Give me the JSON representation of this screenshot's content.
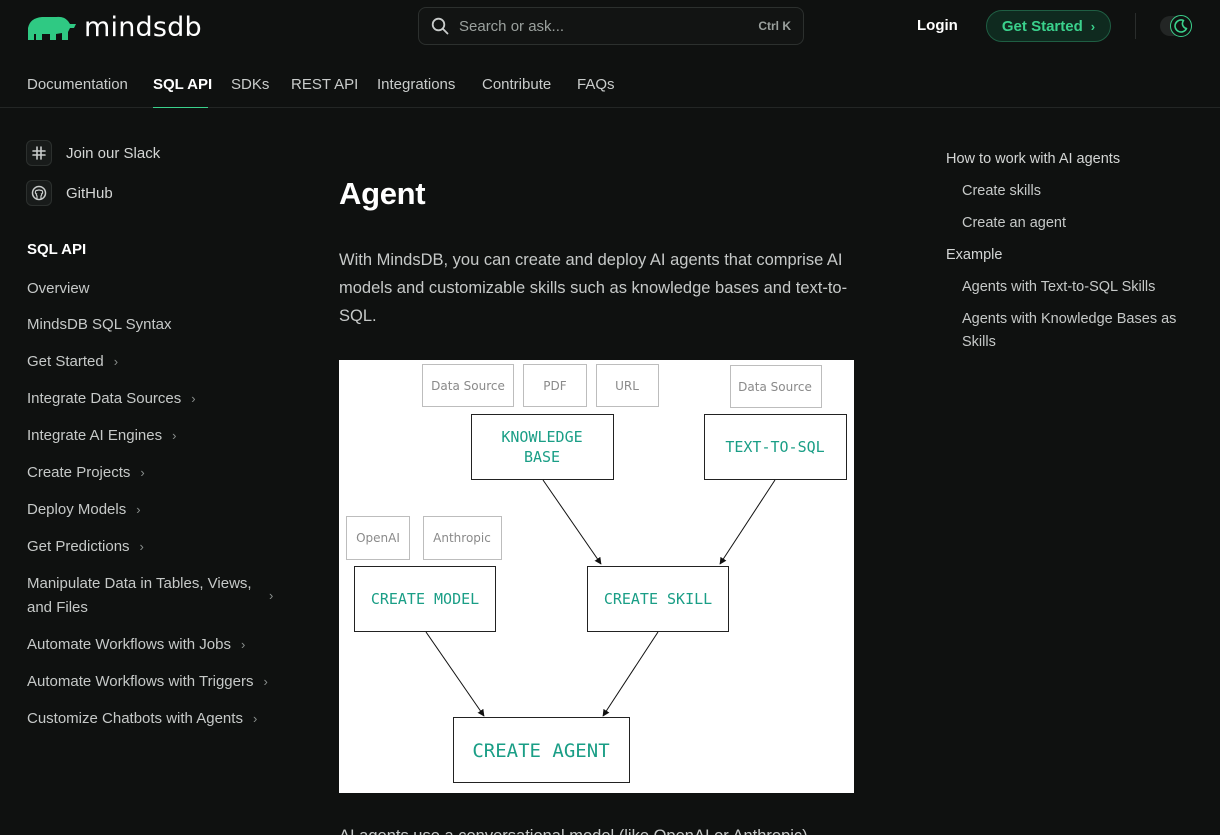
{
  "brand": {
    "logo_text": "mindsdb",
    "accent": "#3ad18c",
    "logo_color": "#2fc983"
  },
  "header": {
    "search_placeholder": "Search or ask...",
    "search_shortcut": "Ctrl K",
    "login_label": "Login",
    "get_started_label": "Get Started"
  },
  "nav": {
    "tabs": [
      {
        "label": "Documentation"
      },
      {
        "label": "SQL API",
        "active": true
      },
      {
        "label": "SDKs"
      },
      {
        "label": "REST API"
      },
      {
        "label": "Integrations"
      },
      {
        "label": "Contribute"
      },
      {
        "label": "FAQs"
      }
    ]
  },
  "sidebar": {
    "links": [
      {
        "label": "Join our Slack",
        "icon": "slack-icon"
      },
      {
        "label": "GitHub",
        "icon": "github-icon"
      }
    ],
    "section_title": "SQL API",
    "items": [
      {
        "label": "Overview"
      },
      {
        "label": "MindsDB SQL Syntax"
      },
      {
        "label": "Get Started",
        "expandable": true
      },
      {
        "label": "Integrate Data Sources",
        "expandable": true
      },
      {
        "label": "Integrate AI Engines",
        "expandable": true
      },
      {
        "label": "Create Projects",
        "expandable": true
      },
      {
        "label": "Deploy Models",
        "expandable": true
      },
      {
        "label": "Get Predictions",
        "expandable": true
      },
      {
        "label": "Manipulate Data in Tables, Views, and Files",
        "expandable": true
      },
      {
        "label": "Automate Workflows with Jobs",
        "expandable": true
      },
      {
        "label": "Automate Workflows with Triggers",
        "expandable": true
      },
      {
        "label": "Customize Chatbots with Agents",
        "expandable": true
      }
    ]
  },
  "main": {
    "title": "Agent",
    "intro": "With MindsDB, you can create and deploy AI agents that comprise AI models and customizable skills such as knowledge bases and text-to-SQL.",
    "bottom_text": "AI agents use a conversational model (like OpenAI or Anthropic)"
  },
  "diagram": {
    "sources_kb": [
      "Data Source",
      "PDF",
      "URL"
    ],
    "source_sql": "Data Source",
    "providers": [
      "OpenAI",
      "Anthropic"
    ],
    "kb_line1": "KNOWLEDGE",
    "kb_line2": "BASE",
    "text_to_sql": "TEXT-TO-SQL",
    "create_model": "CREATE MODEL",
    "create_skill": "CREATE SKILL",
    "create_agent": "CREATE AGENT",
    "node_text_color": "#1a9e86"
  },
  "toc": {
    "items": [
      {
        "label": "How to work with AI agents",
        "level": 1
      },
      {
        "label": "Create skills",
        "level": 2
      },
      {
        "label": "Create an agent",
        "level": 2
      },
      {
        "label": "Example",
        "level": 1
      },
      {
        "label": "Agents with Text-to-SQL Skills",
        "level": 2
      },
      {
        "label": "Agents with Knowledge Bases as Skills",
        "level": 2
      }
    ]
  }
}
